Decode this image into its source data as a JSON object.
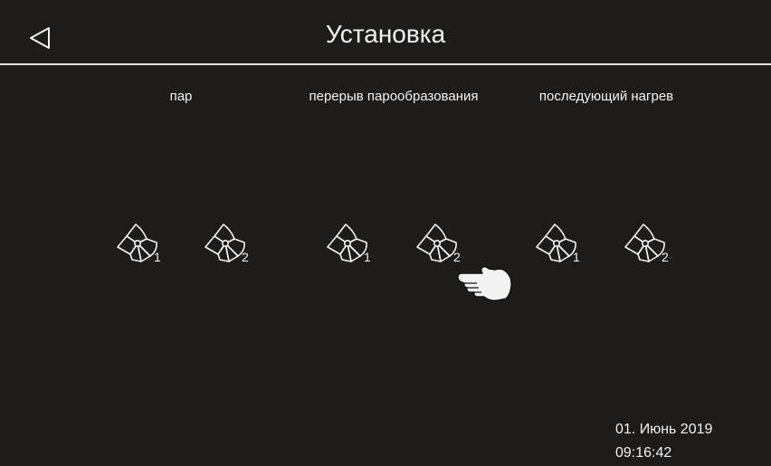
{
  "header": {
    "title": "Установка",
    "back_icon": "back-triangle-icon"
  },
  "groups": [
    {
      "label": "пар",
      "fans": [
        {
          "icon": "fan-icon",
          "number": "1"
        },
        {
          "icon": "fan-icon",
          "number": "2"
        }
      ]
    },
    {
      "label": "перерыв парообразования",
      "fans": [
        {
          "icon": "fan-icon",
          "number": "1"
        },
        {
          "icon": "fan-icon",
          "number": "2"
        }
      ]
    },
    {
      "label": "последующий нагрев",
      "fans": [
        {
          "icon": "fan-icon",
          "number": "1"
        },
        {
          "icon": "fan-icon",
          "number": "2"
        }
      ]
    }
  ],
  "footer": {
    "date": "01. Июнь 2019",
    "time": "09:16:42"
  },
  "colors": {
    "background": "#1e1c1b",
    "foreground": "#f2f2f2"
  }
}
